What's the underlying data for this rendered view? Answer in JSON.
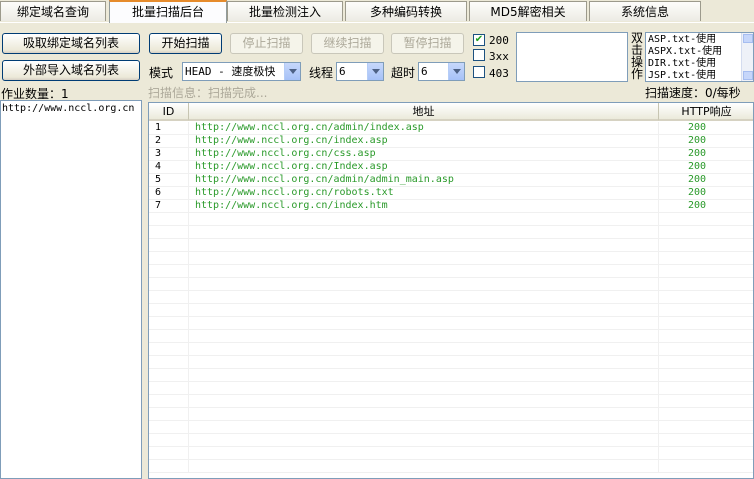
{
  "tabs": [
    {
      "label": "绑定域名查询",
      "active": false
    },
    {
      "label": "批量扫描后台",
      "active": true
    },
    {
      "label": "批量检测注入",
      "active": false
    },
    {
      "label": "多种编码转换",
      "active": false
    },
    {
      "label": "MD5解密相关",
      "active": false
    },
    {
      "label": "系统信息",
      "active": false
    }
  ],
  "left": {
    "absorb_button": "吸取绑定域名列表",
    "import_button": "外部导入域名列表",
    "job_count_label": "作业数量：1",
    "domains": [
      "http://www.nccl.org.cn"
    ]
  },
  "controls": {
    "start": "开始扫描",
    "stop": "停止扫描",
    "continue": "继续扫描",
    "pause": "暂停扫描",
    "mode_label": "模式",
    "mode_value": "HEAD - 速度极快",
    "thread_label": "线程",
    "thread_value": "6",
    "timeout_label": "超时",
    "timeout_value": "6",
    "scan_info": "扫描信息：扫描完成...",
    "scan_speed": "扫描速度：0/每秒"
  },
  "filters": [
    {
      "label": "200",
      "checked": true
    },
    {
      "label": "3xx",
      "checked": false
    },
    {
      "label": "403",
      "checked": false
    }
  ],
  "dict": {
    "vertical_label": [
      "双",
      "击",
      "操",
      "作"
    ],
    "items": [
      "ASP.txt-使用",
      "ASPX.txt-使用",
      "DIR.txt-使用",
      "JSP.txt-使用"
    ]
  },
  "table": {
    "headers": [
      "ID",
      "地址",
      "HTTP响应"
    ],
    "rows": [
      {
        "id": "1",
        "url": "http://www.nccl.org.cn/admin/index.asp",
        "code": "200"
      },
      {
        "id": "2",
        "url": "http://www.nccl.org.cn/index.asp",
        "code": "200"
      },
      {
        "id": "3",
        "url": "http://www.nccl.org.cn/css.asp",
        "code": "200"
      },
      {
        "id": "4",
        "url": "http://www.nccl.org.cn/Index.asp",
        "code": "200"
      },
      {
        "id": "5",
        "url": "http://www.nccl.org.cn/admin/admin_main.asp",
        "code": "200"
      },
      {
        "id": "6",
        "url": "http://www.nccl.org.cn/robots.txt",
        "code": "200"
      },
      {
        "id": "7",
        "url": "http://www.nccl.org.cn/index.htm",
        "code": "200"
      }
    ]
  },
  "colors": {
    "result_text": "#2a9a2a",
    "active_tab_accent": "#e68b2c"
  }
}
